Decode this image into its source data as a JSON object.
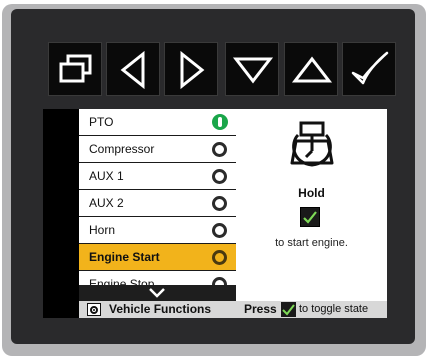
{
  "buttons": [
    {
      "icon": "windows-icon"
    },
    {
      "icon": "left-arrow-icon"
    },
    {
      "icon": "right-arrow-icon"
    },
    {
      "icon": "down-arrow-icon"
    },
    {
      "icon": "up-arrow-icon"
    },
    {
      "icon": "checkmark-icon"
    }
  ],
  "list": {
    "items": [
      {
        "label": "PTO",
        "status": "on"
      },
      {
        "label": "Compressor",
        "status": "off"
      },
      {
        "label": "AUX 1",
        "status": "off"
      },
      {
        "label": "AUX 2",
        "status": "off"
      },
      {
        "label": "Horn",
        "status": "off"
      },
      {
        "label": "Engine Start",
        "status": "off",
        "selected": true
      },
      {
        "label": "Engine Stop",
        "status": "off"
      }
    ]
  },
  "detail": {
    "icon": "engine-key-icon",
    "hold_label": "Hold",
    "instruction": "to start engine."
  },
  "footer": {
    "section_title": "Vehicle Functions",
    "press_label": "Press",
    "toggle_text": "to toggle state"
  },
  "colors": {
    "selected": "#f2b31b",
    "status_on": "#1aa64a",
    "check_green": "#7ed957"
  }
}
